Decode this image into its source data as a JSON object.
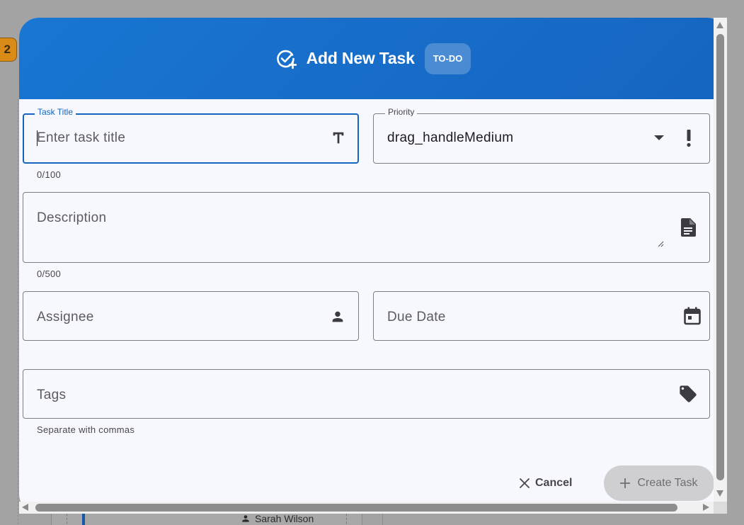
{
  "background": {
    "badge_count": "2",
    "card_assignee": "Sarah Wilson"
  },
  "dialog": {
    "title": "Add New Task",
    "status_chip": "TO-DO",
    "header_icon": "add-task-icon"
  },
  "form": {
    "task_title": {
      "label": "Task Title",
      "placeholder": "Enter task title",
      "value": "",
      "counter": "0/100",
      "icon": "title-icon"
    },
    "priority": {
      "label": "Priority",
      "value": "drag_handleMedium",
      "icon": "priority-high-icon"
    },
    "description": {
      "placeholder": "Description",
      "counter": "0/500",
      "icon": "description-icon"
    },
    "assignee": {
      "placeholder": "Assignee",
      "icon": "person-icon"
    },
    "due_date": {
      "placeholder": "Due Date",
      "icon": "calendar-icon"
    },
    "tags": {
      "placeholder": "Tags",
      "helper": "Separate with commas",
      "icon": "tag-icon"
    }
  },
  "actions": {
    "cancel_label": "Cancel",
    "create_label": "Create Task"
  },
  "colors": {
    "header": "#1976d2",
    "focus": "#1565c0",
    "dialog_bg": "#f7f8fd"
  }
}
